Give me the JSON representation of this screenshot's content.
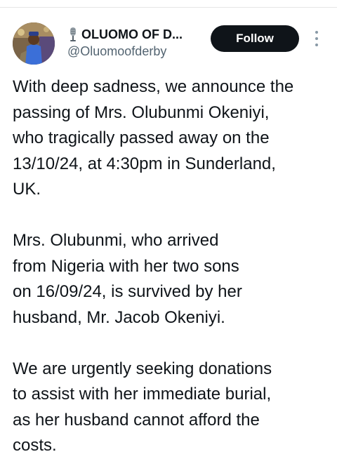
{
  "post": {
    "author": {
      "display_name": "OLUOMO OF D...",
      "handle": "@Oluomoofderby",
      "name_prefix_icon": "microphone-icon",
      "avatar_icon": "avatar"
    },
    "follow_label": "Follow",
    "more_icon": "more-vertical-icon",
    "paragraphs": [
      {
        "lines": [
          "With deep sadness, we announce the",
          "passing of Mrs. Olubunmi Okeniyi,",
          "who tragically passed away on the",
          "13/10/24, at 4:30pm in Sunderland,",
          "UK."
        ]
      },
      {
        "lines": [
          "Mrs. Olubunmi, who arrived",
          "from Nigeria with her two sons",
          "on 16/09/24, is survived by her",
          "husband, Mr. Jacob Okeniyi."
        ]
      },
      {
        "lines": [
          "We are urgently seeking donations",
          "to assist with her immediate burial,",
          "as her husband cannot afford the",
          "costs."
        ]
      }
    ]
  },
  "colors": {
    "text": "#0f1419",
    "secondary_text": "#536471",
    "follow_bg": "#0f1419",
    "follow_text": "#ffffff"
  }
}
